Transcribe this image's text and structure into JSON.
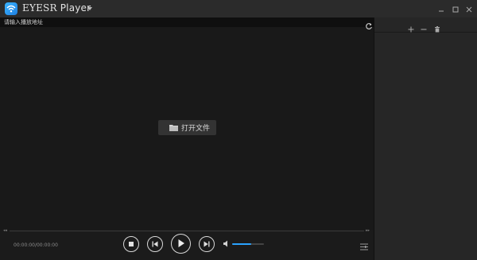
{
  "app": {
    "brand": "EYESR",
    "name": "Player"
  },
  "icons": {
    "logo": "wifi-logo-icon",
    "dropdown": "chevron-down-icon",
    "minimize": "minimize-icon",
    "maximize": "maximize-icon",
    "close": "close-icon",
    "refresh": "refresh-icon",
    "folder": "folder-icon",
    "add": "plus-icon",
    "remove": "minus-icon",
    "delete": "trash-icon",
    "stop": "stop-icon",
    "prev": "skip-previous-icon",
    "play": "play-icon",
    "next": "skip-next-icon",
    "volume": "volume-icon",
    "playlist": "playlist-settings-icon"
  },
  "url_bar": {
    "placeholder": "请输入播放地址",
    "value": ""
  },
  "open_file": {
    "label": "打开文件"
  },
  "playback": {
    "time": "00:00:00/00:00:00",
    "progress_percent": 0,
    "volume_percent": 60,
    "seek_back": "◂◂",
    "seek_forward": "▸▸"
  },
  "colors": {
    "accent": "#1ea0ff",
    "background": "#191919",
    "panel": "#262626",
    "titlebar": "#2b2b2b"
  }
}
